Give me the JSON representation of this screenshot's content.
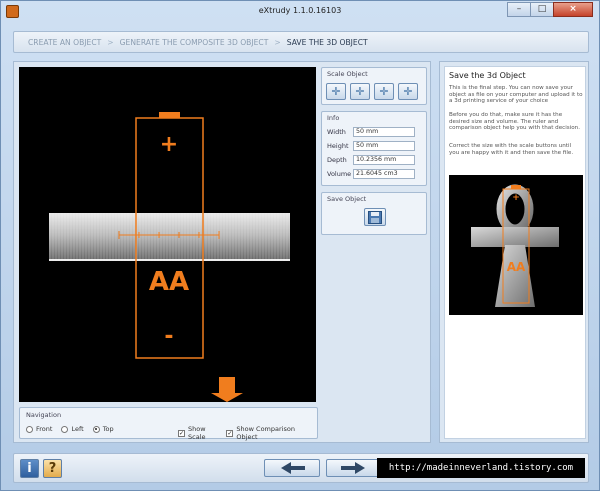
{
  "window": {
    "title": "eXtrudy 1.1.0.16103"
  },
  "breadcrumb": [
    "CREATE AN OBJECT",
    "GENERATE THE COMPOSITE 3D OBJECT",
    "SAVE THE 3D OBJECT"
  ],
  "breadcrumb_separator": ">",
  "viewport": {
    "battery_label": "AA",
    "plus": "+",
    "minus": "-"
  },
  "navigation": {
    "label": "Navigation",
    "views": [
      "Front",
      "Left",
      "Top"
    ],
    "selected_view": "Top",
    "show_scale_label": "Show Scale",
    "show_comparison_label": "Show Comparison Object",
    "show_scale": true,
    "show_comparison": true
  },
  "scale": {
    "label": "Scale Object",
    "buttons": [
      "scale-all",
      "scale-x",
      "scale-y",
      "scale-z"
    ]
  },
  "info": {
    "label": "Info",
    "rows": [
      {
        "key": "Width",
        "value": "50 mm"
      },
      {
        "key": "Height",
        "value": "50 mm"
      },
      {
        "key": "Depth",
        "value": "10.2356 mm"
      },
      {
        "key": "Volume",
        "value": "21.6045 cm3"
      }
    ]
  },
  "save": {
    "label": "Save Object"
  },
  "help": {
    "title": "Save the 3d Object",
    "p1": "This is the final step. You can now save your object as file on your computer and upload it to a 3d printing service of your choice",
    "p2": "Before you do that, make sure it has the desired size and volume. The ruler and comparison object help you with that decision.",
    "p3": "Correct the size with the scale buttons until you are happy with it and then save the file."
  },
  "watermark": "http://madeinneverland.tistory.com",
  "colors": {
    "accent": "#f07d1e",
    "window_bg": "#c3d6ec",
    "panel_border": "#a6bbd3"
  }
}
